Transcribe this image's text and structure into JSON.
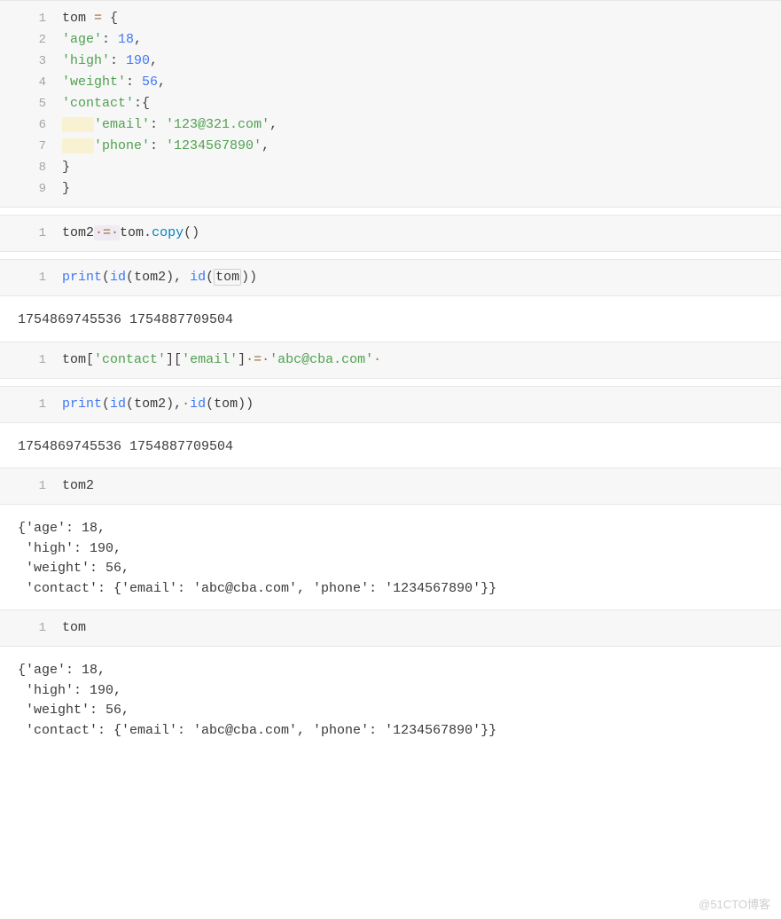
{
  "cells": [
    {
      "type": "code",
      "lines": [
        [
          {
            "t": "tom ",
            "c": "tok-var"
          },
          {
            "t": "=",
            "c": "tok-op"
          },
          {
            "t": " {",
            "c": "tok-punc"
          }
        ],
        [
          {
            "t": "'age'",
            "c": "tok-str"
          },
          {
            "t": ": ",
            "c": "tok-punc"
          },
          {
            "t": "18",
            "c": "tok-num"
          },
          {
            "t": ",",
            "c": "tok-punc"
          }
        ],
        [
          {
            "t": "'high'",
            "c": "tok-str"
          },
          {
            "t": ": ",
            "c": "tok-punc"
          },
          {
            "t": "190",
            "c": "tok-num"
          },
          {
            "t": ",",
            "c": "tok-punc"
          }
        ],
        [
          {
            "t": "'weight'",
            "c": "tok-str"
          },
          {
            "t": ": ",
            "c": "tok-punc"
          },
          {
            "t": "56",
            "c": "tok-num"
          },
          {
            "t": ",",
            "c": "tok-punc"
          }
        ],
        [
          {
            "t": "'contact'",
            "c": "tok-str"
          },
          {
            "t": ":{",
            "c": "tok-punc"
          }
        ],
        [
          {
            "t": "    ",
            "c": "hl-leading"
          },
          {
            "t": "'email'",
            "c": "tok-str"
          },
          {
            "t": ": ",
            "c": "tok-punc"
          },
          {
            "t": "'123@321.com'",
            "c": "tok-str"
          },
          {
            "t": ",",
            "c": "tok-punc"
          }
        ],
        [
          {
            "t": "    ",
            "c": "hl-leading"
          },
          {
            "t": "'phone'",
            "c": "tok-str"
          },
          {
            "t": ": ",
            "c": "tok-punc"
          },
          {
            "t": "'1234567890'",
            "c": "tok-str"
          },
          {
            "t": ",",
            "c": "tok-punc"
          }
        ],
        [
          {
            "t": "}",
            "c": "tok-punc"
          }
        ],
        [
          {
            "t": "}",
            "c": "tok-punc"
          }
        ]
      ]
    },
    {
      "type": "code",
      "lines": [
        [
          {
            "t": "tom2",
            "c": "tok-var"
          },
          {
            "t": "·=·",
            "c": "tok-dot hl-assign"
          },
          {
            "t": "tom",
            "c": "tok-var"
          },
          {
            "t": ".",
            "c": "tok-punc"
          },
          {
            "t": "copy",
            "c": "tok-attr"
          },
          {
            "t": "()",
            "c": "tok-punc"
          }
        ]
      ]
    },
    {
      "type": "code",
      "lines": [
        [
          {
            "t": "print",
            "c": "tok-func"
          },
          {
            "t": "(",
            "c": "tok-punc"
          },
          {
            "t": "id",
            "c": "tok-func"
          },
          {
            "t": "(",
            "c": "tok-punc"
          },
          {
            "t": "tom2",
            "c": "tok-var"
          },
          {
            "t": "), ",
            "c": "tok-punc"
          },
          {
            "t": "id",
            "c": "tok-func"
          },
          {
            "t": "(",
            "c": "tok-punc"
          },
          {
            "t": "tom",
            "c": "tok-var obj-box"
          },
          {
            "t": "))",
            "c": "tok-punc"
          }
        ]
      ]
    },
    {
      "type": "output",
      "text": "1754869745536 1754887709504"
    },
    {
      "type": "code",
      "lines": [
        [
          {
            "t": "tom",
            "c": "tok-var"
          },
          {
            "t": "[",
            "c": "tok-punc"
          },
          {
            "t": "'contact'",
            "c": "tok-str"
          },
          {
            "t": "][",
            "c": "tok-punc"
          },
          {
            "t": "'email'",
            "c": "tok-str"
          },
          {
            "t": "]",
            "c": "tok-punc"
          },
          {
            "t": "·=·",
            "c": "tok-dot"
          },
          {
            "t": "'abc@cba.com'",
            "c": "tok-str"
          },
          {
            "t": "·",
            "c": "tok-dot"
          }
        ]
      ]
    },
    {
      "type": "code",
      "lines": [
        [
          {
            "t": "print",
            "c": "tok-func"
          },
          {
            "t": "(",
            "c": "tok-punc"
          },
          {
            "t": "id",
            "c": "tok-func"
          },
          {
            "t": "(",
            "c": "tok-punc"
          },
          {
            "t": "tom2",
            "c": "tok-var"
          },
          {
            "t": "),",
            "c": "tok-punc"
          },
          {
            "t": "·",
            "c": "tok-dot"
          },
          {
            "t": "id",
            "c": "tok-func"
          },
          {
            "t": "(",
            "c": "tok-punc"
          },
          {
            "t": "tom",
            "c": "tok-var"
          },
          {
            "t": "))",
            "c": "tok-punc"
          }
        ]
      ]
    },
    {
      "type": "output",
      "text": "1754869745536 1754887709504"
    },
    {
      "type": "code",
      "lines": [
        [
          {
            "t": "tom2",
            "c": "tok-var"
          }
        ]
      ]
    },
    {
      "type": "output",
      "text": "{'age': 18,\n 'high': 190,\n 'weight': 56,\n 'contact': {'email': 'abc@cba.com', 'phone': '1234567890'}}"
    },
    {
      "type": "code",
      "lines": [
        [
          {
            "t": "tom",
            "c": "tok-var"
          }
        ]
      ]
    },
    {
      "type": "output",
      "text": "{'age': 18,\n 'high': 190,\n 'weight': 56,\n 'contact': {'email': 'abc@cba.com', 'phone': '1234567890'}}"
    }
  ],
  "watermark": "@51CTO博客"
}
